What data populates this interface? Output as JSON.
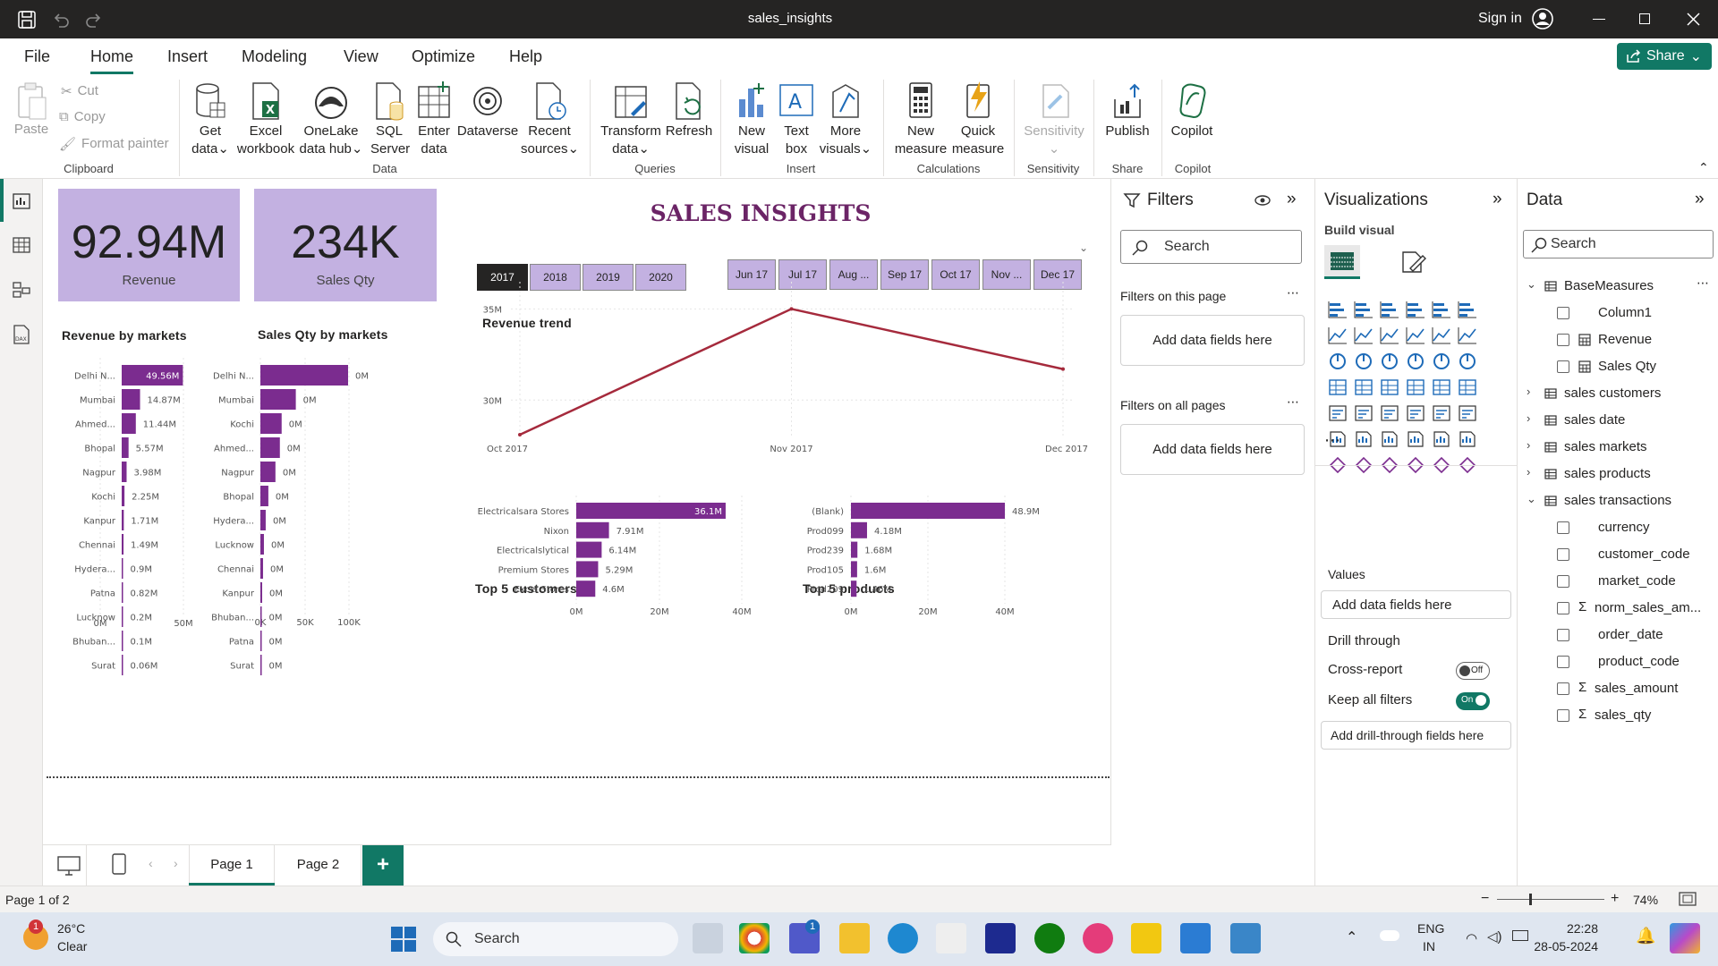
{
  "window": {
    "title": "sales_insights",
    "sign_in": "Sign in"
  },
  "menu": {
    "items": [
      "File",
      "Home",
      "Insert",
      "Modeling",
      "View",
      "Optimize",
      "Help"
    ],
    "active": "Home",
    "share": "Share"
  },
  "ribbon": {
    "clipboard": {
      "paste": "Paste",
      "cut": "Cut",
      "copy": "Copy",
      "format_painter": "Format painter",
      "group": "Clipboard"
    },
    "data": {
      "get_data": "Get",
      "get_data2": "data",
      "excel": "Excel",
      "excel2": "workbook",
      "onelake": "OneLake",
      "onelake2": "data hub",
      "sql": "SQL",
      "sql2": "Server",
      "enter": "Enter",
      "enter2": "data",
      "dataverse": "Dataverse",
      "recent": "Recent",
      "recent2": "sources",
      "group": "Data"
    },
    "queries": {
      "transform": "Transform",
      "transform2": "data",
      "refresh": "Refresh",
      "group": "Queries"
    },
    "insert": {
      "new_visual": "New",
      "new_visual2": "visual",
      "text_box": "Text",
      "text_box2": "box",
      "more_visuals": "More",
      "more_visuals2": "visuals",
      "group": "Insert"
    },
    "calculations": {
      "new_measure": "New",
      "new_measure2": "measure",
      "quick_measure": "Quick",
      "quick_measure2": "measure",
      "group": "Calculations"
    },
    "sensitivity": {
      "label": "Sensitivity",
      "group": "Sensitivity"
    },
    "share": {
      "publish": "Publish",
      "group": "Share"
    },
    "copilot": {
      "label": "Copilot",
      "group": "Copilot"
    }
  },
  "report": {
    "title": "SALES INSIGHTS",
    "kpi_revenue": {
      "value": "92.94M",
      "label": "Revenue"
    },
    "kpi_qty": {
      "value": "234K",
      "label": "Sales Qty"
    },
    "years": [
      "2017",
      "2018",
      "2019",
      "2020"
    ],
    "selected_year": "2017",
    "months": [
      "Jun 17",
      "Jul 17",
      "Aug ...",
      "Sep 17",
      "Oct 17",
      "Nov ...",
      "Dec 17"
    ]
  },
  "chart_data": [
    {
      "type": "bar",
      "title": "Revenue by markets",
      "categories": [
        "Delhi N...",
        "Mumbai",
        "Ahmed...",
        "Bhopal",
        "Nagpur",
        "Kochi",
        "Kanpur",
        "Chennai",
        "Hydera...",
        "Patna",
        "Lucknow",
        "Bhuban...",
        "Surat"
      ],
      "values": [
        49.56,
        14.87,
        11.44,
        5.57,
        3.98,
        2.25,
        1.71,
        1.49,
        0.9,
        0.82,
        0.2,
        0.1,
        0.06
      ],
      "labels": [
        "49.56M",
        "14.87M",
        "11.44M",
        "5.57M",
        "3.98M",
        "2.25M",
        "1.71M",
        "1.49M",
        "0.9M",
        "0.82M",
        "0.2M",
        "0.1M",
        "0.06M"
      ],
      "xticks": [
        "0M",
        "50M"
      ],
      "xlim": [
        0,
        50
      ],
      "color": "#7b2c8f"
    },
    {
      "type": "bar",
      "title": "Sales Qty by markets",
      "categories": [
        "Delhi N...",
        "Mumbai",
        "Kochi",
        "Ahmed...",
        "Nagpur",
        "Bhopal",
        "Hydera...",
        "Lucknow",
        "Chennai",
        "Kanpur",
        "Bhuban...",
        "Patna",
        "Surat"
      ],
      "values": [
        99,
        40,
        24,
        22,
        17,
        9,
        6,
        4,
        3,
        2,
        1.5,
        1.2,
        0.8
      ],
      "labels": [
        "0M",
        "0M",
        "0M",
        "0M",
        "0M",
        "0M",
        "0M",
        "0M",
        "0M",
        "0M",
        "0M",
        "0M",
        "0M"
      ],
      "xticks": [
        "0K",
        "50K",
        "100K"
      ],
      "xlim": [
        0,
        100
      ],
      "color": "#7b2c8f"
    },
    {
      "type": "line",
      "title": "Revenue trend",
      "x": [
        "Oct 2017",
        "Nov 2017",
        "Dec 2017"
      ],
      "values": [
        28.1,
        35,
        31.7
      ],
      "yticks": [
        "30M",
        "35M"
      ],
      "ylim": [
        28,
        36
      ],
      "color": "#a52a3c"
    },
    {
      "type": "bar",
      "title": "Top 5 customers",
      "categories": [
        "Electricalsara Stores",
        "Nixon",
        "Electricalslytical",
        "Premium Stores",
        "Excel Stores"
      ],
      "values": [
        36.1,
        7.91,
        6.14,
        5.29,
        4.6
      ],
      "labels": [
        "36.1M",
        "7.91M",
        "6.14M",
        "5.29M",
        "4.6M"
      ],
      "xticks": [
        "0M",
        "20M",
        "40M"
      ],
      "xlim": [
        0,
        40
      ],
      "color": "#7b2c8f"
    },
    {
      "type": "bar",
      "title": "Top 5 products",
      "categories": [
        "(Blank)",
        "Prod099",
        "Prod239",
        "Prod105",
        "Prod209"
      ],
      "values": [
        48.9,
        4.18,
        1.68,
        1.6,
        1.46
      ],
      "labels": [
        "48.9M",
        "4.18M",
        "1.68M",
        "1.6M",
        "1.46M"
      ],
      "xticks": [
        "0M",
        "20M",
        "40M"
      ],
      "xlim": [
        0,
        40
      ],
      "color": "#7b2c8f"
    }
  ],
  "filters": {
    "title": "Filters",
    "search": "Search",
    "on_page": "Filters on this page",
    "add": "Add data fields here",
    "all_pages": "Filters on all pages"
  },
  "visualizations": {
    "title": "Visualizations",
    "build": "Build visual",
    "values": "Values",
    "add_values": "Add data fields here",
    "drill": "Drill through",
    "cross_report": "Cross-report",
    "cross_state": "Off",
    "keep_filters": "Keep all filters",
    "keep_state": "On",
    "add_drill": "Add drill-through fields here"
  },
  "data_pane": {
    "title": "Data",
    "search": "Search",
    "tables": [
      {
        "name": "BaseMeasures",
        "expanded": true,
        "fields": [
          {
            "name": "Column1",
            "sigma": false
          },
          {
            "name": "Revenue",
            "sigma": false
          },
          {
            "name": "Sales Qty",
            "sigma": false
          }
        ]
      },
      {
        "name": "sales customers",
        "expanded": false,
        "fields": []
      },
      {
        "name": "sales date",
        "expanded": false,
        "fields": []
      },
      {
        "name": "sales markets",
        "expanded": false,
        "fields": []
      },
      {
        "name": "sales products",
        "expanded": false,
        "fields": []
      },
      {
        "name": "sales transactions",
        "expanded": true,
        "fields": [
          {
            "name": "currency",
            "sigma": false
          },
          {
            "name": "customer_code",
            "sigma": false
          },
          {
            "name": "market_code",
            "sigma": false
          },
          {
            "name": "norm_sales_am...",
            "sigma": true
          },
          {
            "name": "order_date",
            "sigma": false
          },
          {
            "name": "product_code",
            "sigma": false
          },
          {
            "name": "sales_amount",
            "sigma": true
          },
          {
            "name": "sales_qty",
            "sigma": true
          }
        ]
      }
    ]
  },
  "pages": {
    "tabs": [
      "Page 1",
      "Page 2"
    ],
    "active": "Page 1",
    "add": "+"
  },
  "status": {
    "page": "Page 1 of 2",
    "zoom": "74%"
  },
  "taskbar": {
    "temp": "26°C",
    "weather": "Clear",
    "search": "Search",
    "lang1": "ENG",
    "lang2": "IN",
    "time": "22:28",
    "date": "28-05-2024",
    "notif": "1",
    "teams_badge": "1"
  },
  "colors": {
    "accent": "#117865",
    "bar": "#7b2c8f",
    "card": "#c3b1e1",
    "title": "#6b2466",
    "line": "#a52a3c"
  }
}
